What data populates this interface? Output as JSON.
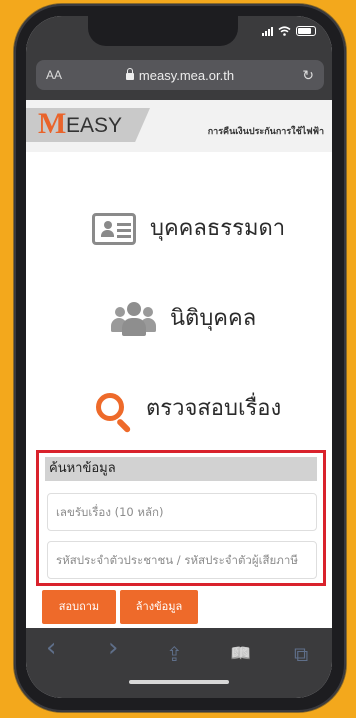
{
  "browser": {
    "aa_label": "AA",
    "url": "measy.mea.or.th",
    "reload_glyph": "↻"
  },
  "header": {
    "logo_m": "M",
    "logo_text": "EASY",
    "tagline": "การคืนเงินประกันการใช้ไฟฟ้า"
  },
  "menu": [
    {
      "label": "บุคคลธรรมดา",
      "icon": "id-card-icon"
    },
    {
      "label": "นิติบุคคล",
      "icon": "group-people-icon"
    },
    {
      "label": "ตรวจสอบเรื่อง",
      "icon": "search-icon"
    }
  ],
  "search": {
    "title": "ค้นหาข้อมูล",
    "request_number_placeholder": "เลขรับเรื่อง (10 หลัก)",
    "id_placeholder": "รหัสประจำตัวประชาชน / รหัสประจำตัวผู้เสียภาษี"
  },
  "buttons": {
    "search": "สอบถาม",
    "clear": "ล้างข้อมูล"
  },
  "toolbar": {
    "back": "‹",
    "forward": "›",
    "share": "⇪",
    "bookmarks": "📖",
    "tabs": "⧉"
  },
  "colors": {
    "accent": "#ee6a2a",
    "highlight_border": "#d9222c",
    "background": "#f3a81c"
  }
}
